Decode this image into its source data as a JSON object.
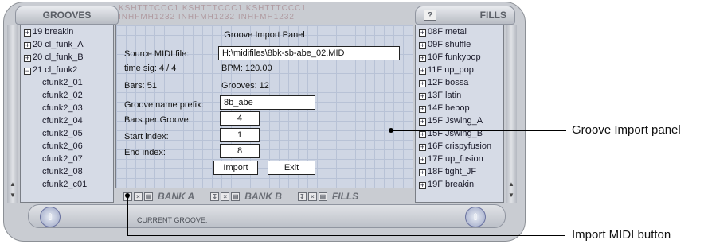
{
  "headers": {
    "grooves": "GROOVES",
    "fills": "FILLS",
    "help": "?"
  },
  "grid_header": {
    "row1": "KSHTTTCCC1  KSHTTTCCC1  KSHTTTCCC1",
    "row2": "INHFMH1232  INHFMH1232  INHFMH1232"
  },
  "grooves": [
    {
      "box": "+",
      "label": "19 breakin"
    },
    {
      "box": "+",
      "label": "20 cl_funk_A"
    },
    {
      "box": "+",
      "label": "20 cl_funk_B"
    },
    {
      "box": "−",
      "label": "21 cl_funk2"
    },
    {
      "label": "cfunk2_01"
    },
    {
      "label": "cfunk2_02"
    },
    {
      "label": "cfunk2_03"
    },
    {
      "label": "cfunk2_04"
    },
    {
      "label": "cfunk2_05"
    },
    {
      "label": "cfunk2_06"
    },
    {
      "label": "cfunk2_07"
    },
    {
      "label": "cfunk2_08"
    },
    {
      "label": "cfunk2_c01"
    }
  ],
  "fills": [
    {
      "box": "+",
      "label": "08F metal"
    },
    {
      "box": "+",
      "label": "09F shuffle"
    },
    {
      "box": "+",
      "label": "10F funkypop"
    },
    {
      "box": "+",
      "label": "11F up_pop"
    },
    {
      "box": "+",
      "label": "12F bossa"
    },
    {
      "box": "+",
      "label": "13F latin"
    },
    {
      "box": "+",
      "label": "14F bebop"
    },
    {
      "box": "+",
      "label": "15F Jswing_A"
    },
    {
      "box": "+",
      "label": "15F Jswing_B"
    },
    {
      "box": "+",
      "label": "16F crispyfusion"
    },
    {
      "box": "+",
      "label": "17F up_fusion"
    },
    {
      "box": "+",
      "label": "18F tight_JF"
    },
    {
      "box": "+",
      "label": "19F breakin"
    }
  ],
  "dialog": {
    "title": "Groove Import Panel",
    "source_label": "Source MIDI file:",
    "source_value": "H:\\midifiles\\8bk-sb-abe_02.MID",
    "timesig": "time sig: 4 / 4",
    "bpm": "BPM: 120.00",
    "bars": "Bars: 51",
    "grooves": "Grooves: 12",
    "prefix_label": "Groove name prefix:",
    "prefix_value": "8b_abe",
    "bpg_label": "Bars per Groove:",
    "bpg_value": "4",
    "start_label": "Start index:",
    "start_value": "1",
    "end_label": "End index:",
    "end_value": "8",
    "import_btn": "Import",
    "exit_btn": "Exit"
  },
  "banks": {
    "a": "BANK A",
    "b": "BANK B",
    "fills": "FILLS"
  },
  "current_groove_label": "CURRENT GROOVE:",
  "callouts": {
    "panel": "Groove Import panel",
    "import_midi": "Import MIDI button"
  }
}
